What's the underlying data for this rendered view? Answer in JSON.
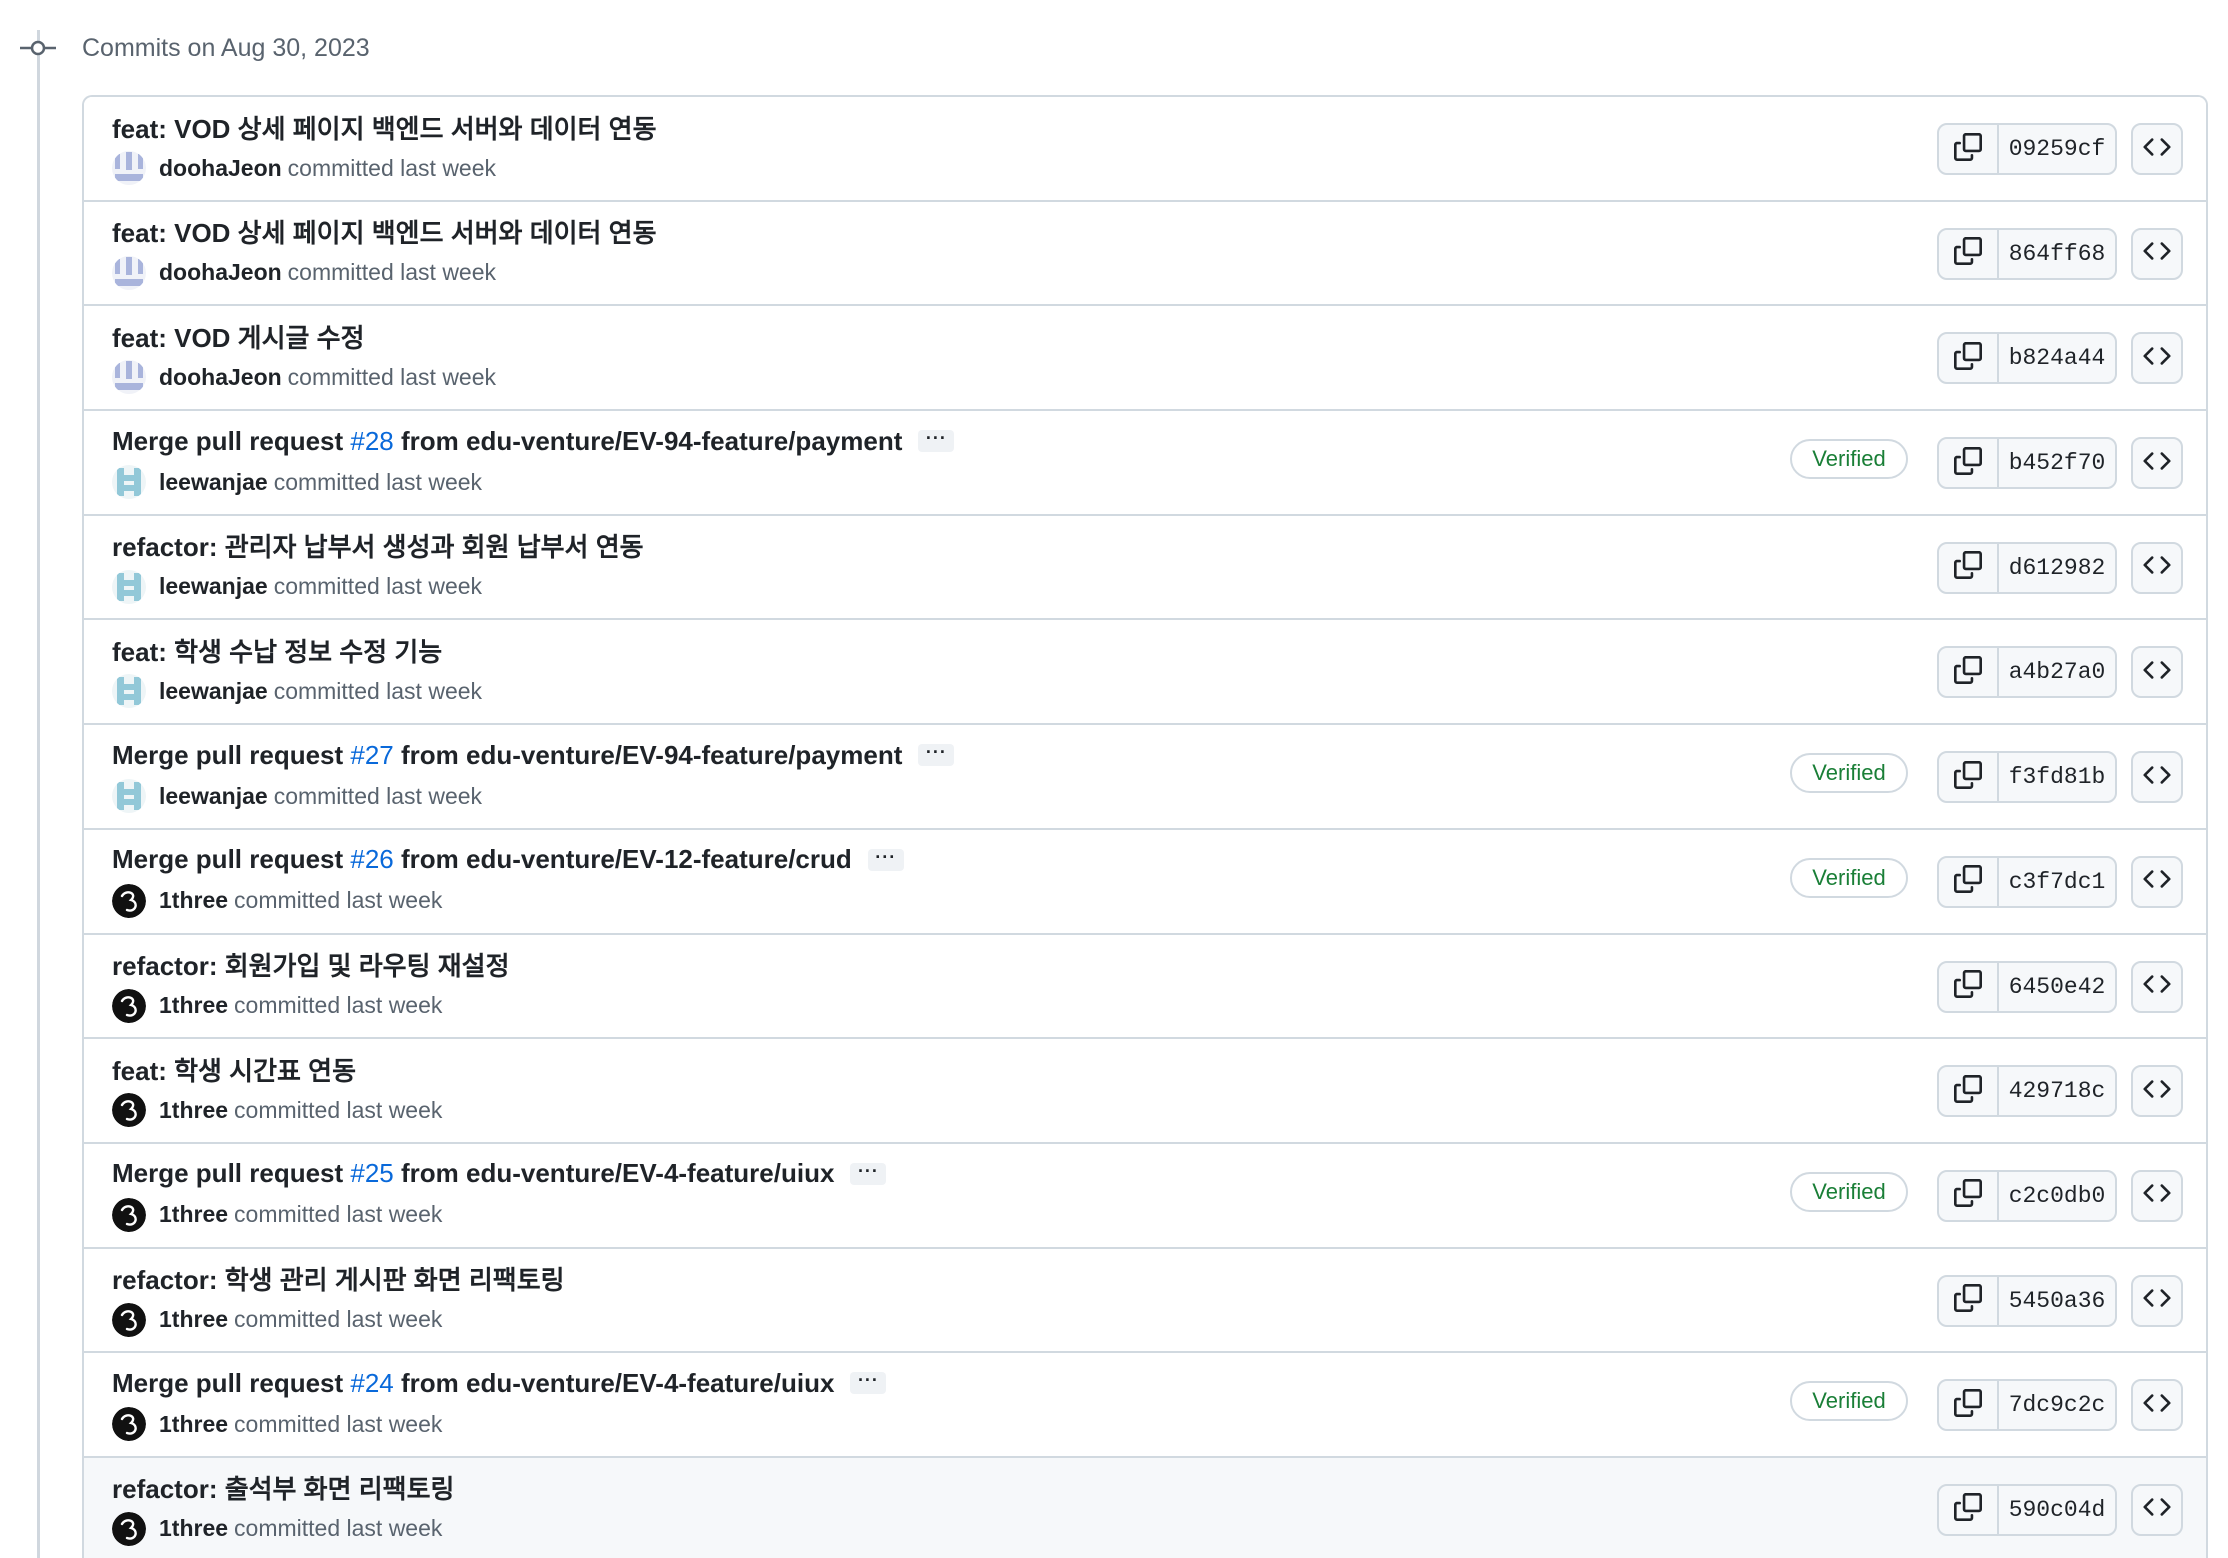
{
  "group": {
    "date_label": "Commits on Aug 30, 2023"
  },
  "verified_label": "Verified",
  "ellipsis_label": "···",
  "commits": [
    {
      "message": "feat: VOD 상세 페이지 백엔드 서버와 데이터 연동",
      "author": "doohaJeon",
      "avatar": "doohaJeon",
      "committed": "committed last week",
      "sha": "09259cf",
      "verified": false,
      "has_ellipsis": false
    },
    {
      "message": "feat: VOD 상세 페이지 백엔드 서버와 데이터 연동",
      "author": "doohaJeon",
      "avatar": "doohaJeon",
      "committed": "committed last week",
      "sha": "864ff68",
      "verified": false,
      "has_ellipsis": false
    },
    {
      "message": "feat: VOD 게시글 수정",
      "author": "doohaJeon",
      "avatar": "doohaJeon",
      "committed": "committed last week",
      "sha": "b824a44",
      "verified": false,
      "has_ellipsis": false
    },
    {
      "message_pre": "Merge pull request ",
      "pr": "#28",
      "message_post": " from edu-venture/EV-94-feature/payment",
      "author": "leewanjae",
      "avatar": "leewanjae",
      "committed": "committed last week",
      "sha": "b452f70",
      "verified": true,
      "has_ellipsis": true
    },
    {
      "message": "refactor: 관리자 납부서 생성과 회원 납부서 연동",
      "author": "leewanjae",
      "avatar": "leewanjae",
      "committed": "committed last week",
      "sha": "d612982",
      "verified": false,
      "has_ellipsis": false
    },
    {
      "message": "feat: 학생 수납 정보 수정 기능",
      "author": "leewanjae",
      "avatar": "leewanjae",
      "committed": "committed last week",
      "sha": "a4b27a0",
      "verified": false,
      "has_ellipsis": false
    },
    {
      "message_pre": "Merge pull request ",
      "pr": "#27",
      "message_post": " from edu-venture/EV-94-feature/payment",
      "author": "leewanjae",
      "avatar": "leewanjae",
      "committed": "committed last week",
      "sha": "f3fd81b",
      "verified": true,
      "has_ellipsis": true
    },
    {
      "message_pre": "Merge pull request ",
      "pr": "#26",
      "message_post": " from edu-venture/EV-12-feature/crud",
      "author": "1three",
      "avatar": "1three",
      "committed": "committed last week",
      "sha": "c3f7dc1",
      "verified": true,
      "has_ellipsis": true
    },
    {
      "message": "refactor: 회원가입 및 라우팅 재설정",
      "author": "1three",
      "avatar": "1three",
      "committed": "committed last week",
      "sha": "6450e42",
      "verified": false,
      "has_ellipsis": false
    },
    {
      "message": "feat: 학생 시간표 연동",
      "author": "1three",
      "avatar": "1three",
      "committed": "committed last week",
      "sha": "429718c",
      "verified": false,
      "has_ellipsis": false
    },
    {
      "message_pre": "Merge pull request ",
      "pr": "#25",
      "message_post": " from edu-venture/EV-4-feature/uiux",
      "author": "1three",
      "avatar": "1three",
      "committed": "committed last week",
      "sha": "c2c0db0",
      "verified": true,
      "has_ellipsis": true
    },
    {
      "message": "refactor: 학생 관리 게시판 화면 리팩토링",
      "author": "1three",
      "avatar": "1three",
      "committed": "committed last week",
      "sha": "5450a36",
      "verified": false,
      "has_ellipsis": false
    },
    {
      "message_pre": "Merge pull request ",
      "pr": "#24",
      "message_post": " from edu-venture/EV-4-feature/uiux",
      "author": "1three",
      "avatar": "1three",
      "committed": "committed last week",
      "sha": "7dc9c2c",
      "verified": true,
      "has_ellipsis": true
    },
    {
      "message": "refactor: 출석부 화면 리팩토링",
      "author": "1three",
      "avatar": "1three",
      "committed": "committed last week",
      "sha": "590c04d",
      "verified": false,
      "has_ellipsis": false,
      "hovered": true
    }
  ],
  "icons": {
    "timeline": "git-commit-icon",
    "copy": "copy-icon",
    "browse": "code-icon"
  },
  "colors": {
    "link": "#0969da",
    "verified": "#1a7f37",
    "muted": "#59636e",
    "border": "#d1d9e0",
    "hover_row": "#f6f8fa"
  }
}
